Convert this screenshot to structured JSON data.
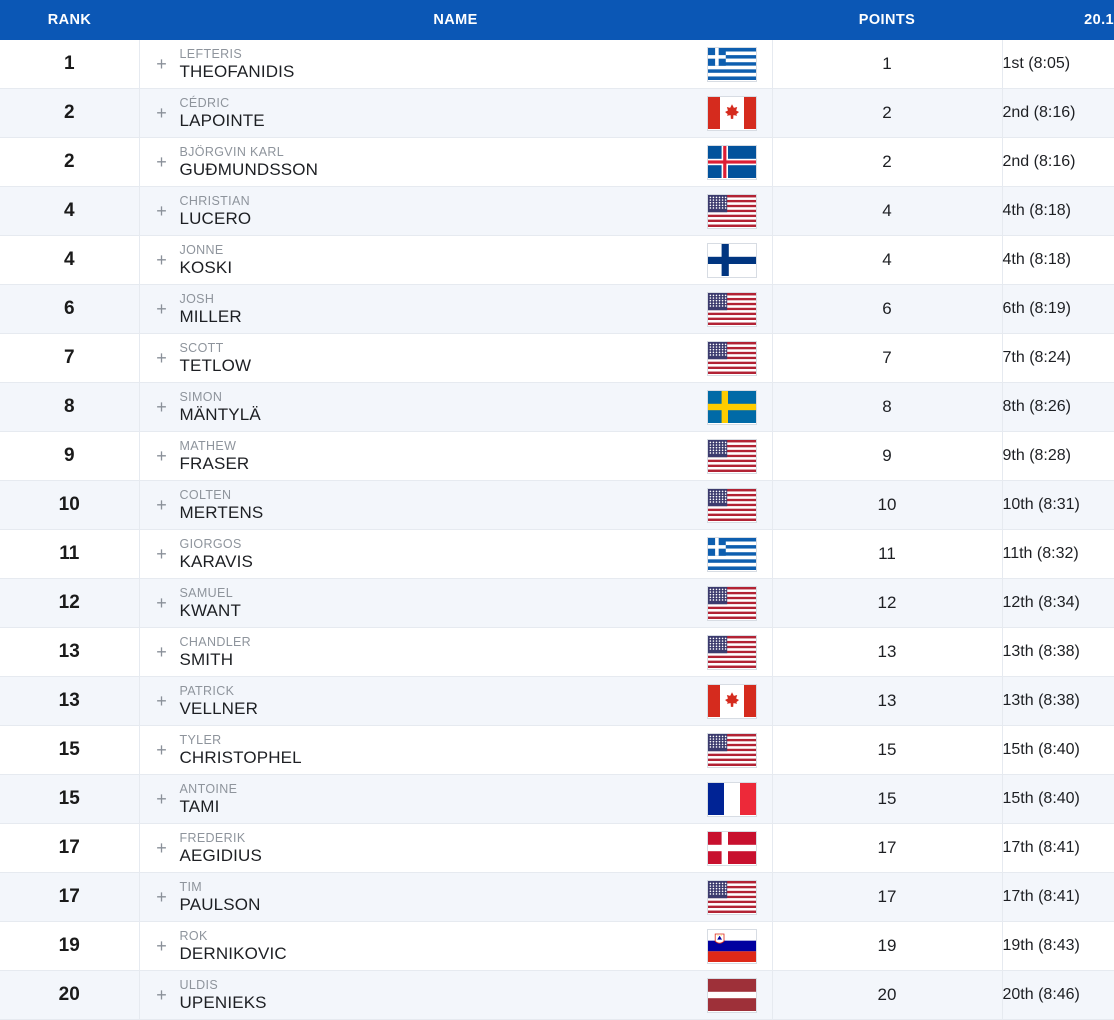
{
  "table": {
    "columns": [
      {
        "key": "rank",
        "label": "RANK"
      },
      {
        "key": "name",
        "label": "NAME"
      },
      {
        "key": "points",
        "label": "POINTS"
      },
      {
        "key": "event",
        "label": "20.1"
      }
    ],
    "expand_icon": "+",
    "accent_color": "#0b57b5",
    "row_alt_color": "#f3f6fb",
    "rows": [
      {
        "rank": "1",
        "first_name": "LEFTERIS",
        "last_name": "THEOFANIDIS",
        "country": "GR",
        "points": "1",
        "event": "1st (8:05)"
      },
      {
        "rank": "2",
        "first_name": "CÉDRIC",
        "last_name": "LAPOINTE",
        "country": "CA",
        "points": "2",
        "event": "2nd (8:16)"
      },
      {
        "rank": "2",
        "first_name": "BJÖRGVIN KARL",
        "last_name": "GUÐMUNDSSON",
        "country": "IS",
        "points": "2",
        "event": "2nd (8:16)"
      },
      {
        "rank": "4",
        "first_name": "CHRISTIAN",
        "last_name": "LUCERO",
        "country": "US",
        "points": "4",
        "event": "4th (8:18)"
      },
      {
        "rank": "4",
        "first_name": "JONNE",
        "last_name": "KOSKI",
        "country": "FI",
        "points": "4",
        "event": "4th (8:18)"
      },
      {
        "rank": "6",
        "first_name": "JOSH",
        "last_name": "MILLER",
        "country": "US",
        "points": "6",
        "event": "6th (8:19)"
      },
      {
        "rank": "7",
        "first_name": "SCOTT",
        "last_name": "TETLOW",
        "country": "US",
        "points": "7",
        "event": "7th (8:24)"
      },
      {
        "rank": "8",
        "first_name": "SIMON",
        "last_name": "MÄNTYLÄ",
        "country": "SE",
        "points": "8",
        "event": "8th (8:26)"
      },
      {
        "rank": "9",
        "first_name": "MATHEW",
        "last_name": "FRASER",
        "country": "US",
        "points": "9",
        "event": "9th (8:28)"
      },
      {
        "rank": "10",
        "first_name": "COLTEN",
        "last_name": "MERTENS",
        "country": "US",
        "points": "10",
        "event": "10th (8:31)"
      },
      {
        "rank": "11",
        "first_name": "GIORGOS",
        "last_name": "KARAVIS",
        "country": "GR",
        "points": "11",
        "event": "11th (8:32)"
      },
      {
        "rank": "12",
        "first_name": "SAMUEL",
        "last_name": "KWANT",
        "country": "US",
        "points": "12",
        "event": "12th (8:34)"
      },
      {
        "rank": "13",
        "first_name": "CHANDLER",
        "last_name": "SMITH",
        "country": "US",
        "points": "13",
        "event": "13th (8:38)"
      },
      {
        "rank": "13",
        "first_name": "PATRICK",
        "last_name": "VELLNER",
        "country": "CA",
        "points": "13",
        "event": "13th (8:38)"
      },
      {
        "rank": "15",
        "first_name": "TYLER",
        "last_name": "CHRISTOPHEL",
        "country": "US",
        "points": "15",
        "event": "15th (8:40)"
      },
      {
        "rank": "15",
        "first_name": "ANTOINE",
        "last_name": "TAMI",
        "country": "FR",
        "points": "15",
        "event": "15th (8:40)"
      },
      {
        "rank": "17",
        "first_name": "FREDERIK",
        "last_name": "AEGIDIUS",
        "country": "DK",
        "points": "17",
        "event": "17th (8:41)"
      },
      {
        "rank": "17",
        "first_name": "TIM",
        "last_name": "PAULSON",
        "country": "US",
        "points": "17",
        "event": "17th (8:41)"
      },
      {
        "rank": "19",
        "first_name": "ROK",
        "last_name": "DERNIKOVIC",
        "country": "SI",
        "points": "19",
        "event": "19th (8:43)"
      },
      {
        "rank": "20",
        "first_name": "ULDIS",
        "last_name": "UPENIEKS",
        "country": "LV",
        "points": "20",
        "event": "20th (8:46)"
      }
    ]
  }
}
